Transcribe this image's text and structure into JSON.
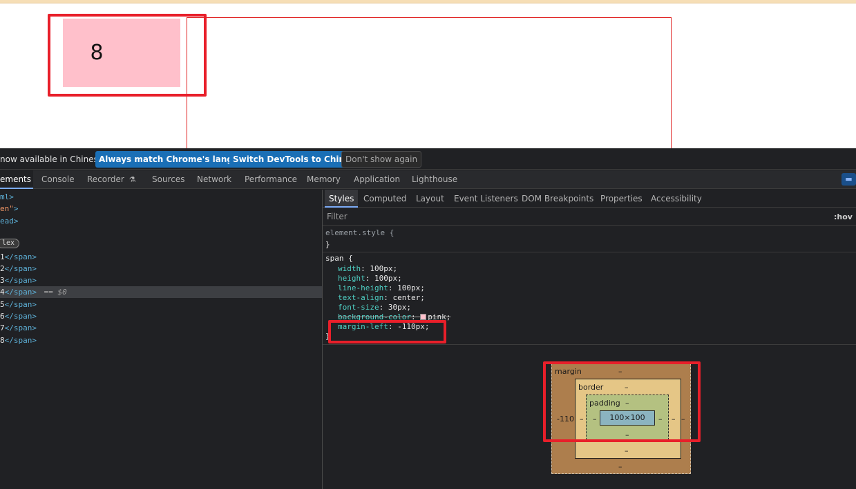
{
  "viewport": {
    "box_number": "8"
  },
  "infobar": {
    "message": "now available in Chinese!",
    "btn_match": "Always match Chrome's language",
    "btn_switch": "Switch DevTools to Chinese",
    "btn_dismiss": "Don't show again"
  },
  "tabs": {
    "elements": "ements",
    "console": "Console",
    "recorder": "Recorder",
    "sources": "Sources",
    "network": "Network",
    "performance": "Performance",
    "memory": "Memory",
    "application": "Application",
    "lighthouse": "Lighthouse"
  },
  "tree": {
    "l1": "ml>",
    "l2_attr": "en\"",
    "l2_close": ">",
    "l3": "ead>",
    "flex_badge": "lex",
    "span_close": "</span>",
    "selected_suffix": "== $0",
    "rows": [
      "1",
      "2",
      "3",
      "4",
      "5",
      "6",
      "7",
      "8"
    ]
  },
  "subtabs": {
    "styles": "Styles",
    "computed": "Computed",
    "layout": "Layout",
    "event_listeners": "Event Listeners",
    "dom_breakpoints": "DOM Breakpoints",
    "properties": "Properties",
    "accessibility": "Accessibility"
  },
  "filter": {
    "placeholder": "Filter",
    "hov": ":hov"
  },
  "styles": {
    "element_style_selector": "element.style {",
    "close_brace": "}",
    "span_selector": "span {",
    "decls": [
      {
        "prop": "width",
        "value": "100px;"
      },
      {
        "prop": "height",
        "value": "100px;"
      },
      {
        "prop": "line-height",
        "value": "100px;"
      },
      {
        "prop": "text-align",
        "value": "center;"
      },
      {
        "prop": "font-size",
        "value": "30px;"
      },
      {
        "prop": "background-color",
        "value": "pink;"
      },
      {
        "prop": "margin-left",
        "value": "-110px;"
      }
    ]
  },
  "box_model": {
    "margin_label": "margin",
    "margin_top": "–",
    "margin_left": "-110",
    "margin_right": "–",
    "margin_bottom": "–",
    "border_label": "border",
    "border_top": "–",
    "border_left": "–",
    "border_right": "–",
    "border_bottom": "–",
    "padding_label": "padding",
    "padding_top": "–",
    "padding_left": "–",
    "padding_right": "–",
    "padding_bottom": "–",
    "content": "100×100"
  },
  "colors": {
    "pink_box": "#ffc0cb",
    "annotation_red": "#e81f2a",
    "devtools_bg": "#202124",
    "primary_button": "#1a6fb6"
  }
}
